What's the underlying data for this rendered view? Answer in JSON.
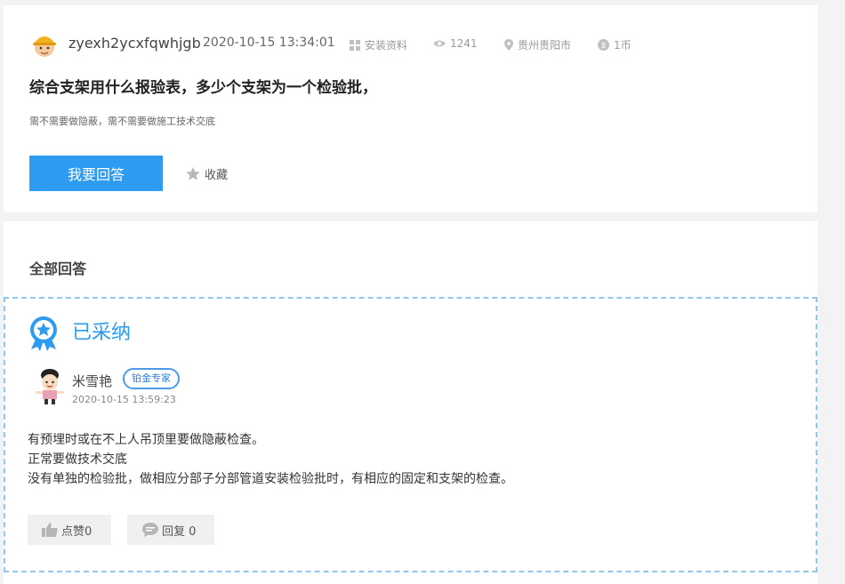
{
  "question": {
    "username": "zyexh2ycxfqwhjgb",
    "time": "2020-10-15 13:34:01",
    "category": "安装资料",
    "views": "1241",
    "location": "贵州贵阳市",
    "reward": "1币",
    "title": "综合支架用什么报验表，多少个支架为一个检验批，",
    "description": "需不需要做隐蔽，需不需要做施工技术交底",
    "answer_button": "我要回答",
    "collect_label": "收藏"
  },
  "answers_section": {
    "title": "全部回答"
  },
  "best_answer": {
    "status": "已采纳",
    "username": "米雪艳",
    "expert_badge": "铂金专家",
    "time": "2020-10-15 13:59:23",
    "lines": [
      "有预埋时或在不上人吊顶里要做隐蔽检查。",
      "正常要做技术交底",
      "没有单独的检验批，做相应分部子分部管道安装检验批时，有相应的固定和支架的检查。"
    ],
    "like_label": "点赞0",
    "reply_label": "回复 0"
  },
  "colors": {
    "accent": "#2d9bf0",
    "dashed_border": "#8fc7ef",
    "meta_icon": "#c0c0c0"
  },
  "icons": {
    "category": "grid-icon",
    "views": "eye-icon",
    "location": "location-pin-icon",
    "reward": "coin-icon",
    "collect": "star-icon",
    "adopted": "award-badge-icon",
    "like": "thumbs-up-icon",
    "reply": "chat-bubble-icon"
  }
}
